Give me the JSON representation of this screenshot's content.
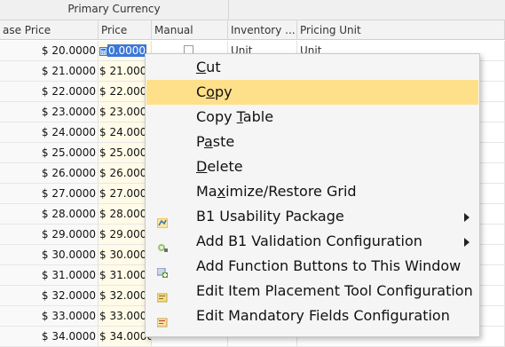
{
  "grid": {
    "group_header": "Primary Currency",
    "columns": {
      "base_price": "ase Price",
      "price": "Price",
      "manual": "Manual",
      "inventory": "Inventory ...",
      "pricing_unit": "Pricing Unit"
    },
    "rows": [
      {
        "base": "$ 20.0000",
        "price": "0.0000",
        "inv": "Unit",
        "pu": "Unit"
      },
      {
        "base": "$ 21.0000",
        "price": "$ 21.0000",
        "inv": "",
        "pu": ""
      },
      {
        "base": "$ 22.0000",
        "price": "$ 22.0000",
        "inv": "",
        "pu": ""
      },
      {
        "base": "$ 23.0000",
        "price": "$ 23.0000",
        "inv": "",
        "pu": ""
      },
      {
        "base": "$ 24.0000",
        "price": "$ 24.0000",
        "inv": "",
        "pu": ""
      },
      {
        "base": "$ 25.0000",
        "price": "$ 25.0000",
        "inv": "",
        "pu": ""
      },
      {
        "base": "$ 26.0000",
        "price": "$ 26.0000",
        "inv": "",
        "pu": ""
      },
      {
        "base": "$ 27.0000",
        "price": "$ 27.0000",
        "inv": "",
        "pu": ""
      },
      {
        "base": "$ 28.0000",
        "price": "$ 28.0000",
        "inv": "",
        "pu": ""
      },
      {
        "base": "$ 29.0000",
        "price": "$ 29.0000",
        "inv": "",
        "pu": ""
      },
      {
        "base": "$ 30.0000",
        "price": "$ 30.0000",
        "inv": "",
        "pu": ""
      },
      {
        "base": "$ 31.0000",
        "price": "$ 31.0000",
        "inv": "",
        "pu": ""
      },
      {
        "base": "$ 32.0000",
        "price": "$ 32.0000",
        "inv": "",
        "pu": ""
      },
      {
        "base": "$ 33.0000",
        "price": "$ 33.0000",
        "inv": "",
        "pu": ""
      },
      {
        "base": "$ 34.0000",
        "price": "$ 34.0000",
        "inv": "",
        "pu": ""
      }
    ]
  },
  "context_menu": {
    "items": [
      {
        "label": "Cut",
        "icon": "",
        "submenu": false,
        "highlighted": false
      },
      {
        "label": "Copy",
        "icon": "",
        "submenu": false,
        "highlighted": true
      },
      {
        "label": "Copy Table",
        "icon": "",
        "submenu": false,
        "highlighted": false
      },
      {
        "label": "Paste",
        "icon": "",
        "submenu": false,
        "highlighted": false
      },
      {
        "label": "Delete",
        "icon": "",
        "submenu": false,
        "highlighted": false
      },
      {
        "label": "Maximize/Restore Grid",
        "icon": "",
        "submenu": false,
        "highlighted": false
      },
      {
        "label": "B1 Usability Package",
        "icon": "usability-package-icon",
        "submenu": true,
        "highlighted": false
      },
      {
        "label": "Add B1 Validation Configuration",
        "icon": "add-validation-icon",
        "submenu": true,
        "highlighted": false
      },
      {
        "label": "Add Function Buttons to This Window",
        "icon": "add-function-buttons-icon",
        "submenu": false,
        "highlighted": false
      },
      {
        "label": "Edit Item Placement Tool Configuration",
        "icon": "edit-placement-icon",
        "submenu": false,
        "highlighted": false
      },
      {
        "label": "Edit Mandatory Fields Configuration",
        "icon": "edit-mandatory-icon",
        "submenu": false,
        "highlighted": false
      }
    ]
  },
  "colors": {
    "highlight": "#ffe08a",
    "selection": "#3b78d8",
    "menu_bg": "#f5f5f5"
  }
}
